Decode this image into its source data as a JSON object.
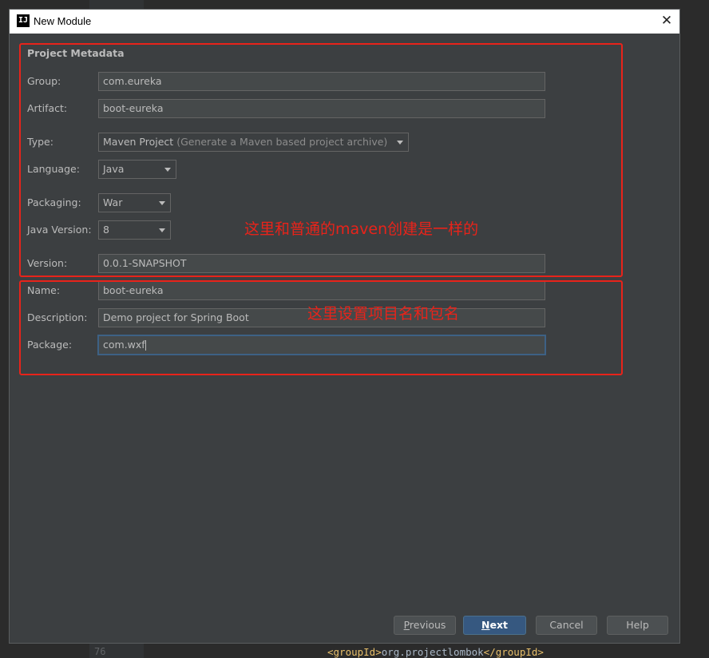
{
  "background": {
    "line_number": "76",
    "code_open_tag": "<groupId>",
    "code_text": "org.projectlombok",
    "code_close_tag": "</groupId>"
  },
  "dialog": {
    "title": "New Module",
    "app_icon": "IJ",
    "close_glyph": "✕"
  },
  "form": {
    "section_title": "Project Metadata",
    "group": {
      "label": "Group:",
      "value": "com.eureka"
    },
    "artifact": {
      "label": "Artifact:",
      "value": "boot-eureka"
    },
    "type": {
      "label": "Type:",
      "value": "Maven Project",
      "hint": "(Generate a Maven based project archive)"
    },
    "language": {
      "label": "Language:",
      "value": "Java"
    },
    "packaging": {
      "label": "Packaging:",
      "value": "War"
    },
    "java_version": {
      "label": "Java Version:",
      "value": "8"
    },
    "version": {
      "label": "Version:",
      "value": "0.0.1-SNAPSHOT"
    },
    "name": {
      "label": "Name:",
      "value": "boot-eureka"
    },
    "description": {
      "label": "Description:",
      "value": "Demo project for Spring Boot"
    },
    "package": {
      "label": "Package:",
      "value": "com.wxf"
    }
  },
  "annotations": {
    "note1": "这里和普通的maven创建是一样的",
    "note2": "这里设置项目名和包名",
    "color": "#e8231a"
  },
  "buttons": {
    "previous_mnemonic": "P",
    "previous_rest": "revious",
    "next_mnemonic": "N",
    "next_rest": "ext",
    "cancel": "Cancel",
    "help": "Help"
  },
  "colors": {
    "dialog_bg": "#3c3f41",
    "field_bg": "#45494a",
    "primary_button": "#365880",
    "focus_border": "#3d6185"
  }
}
